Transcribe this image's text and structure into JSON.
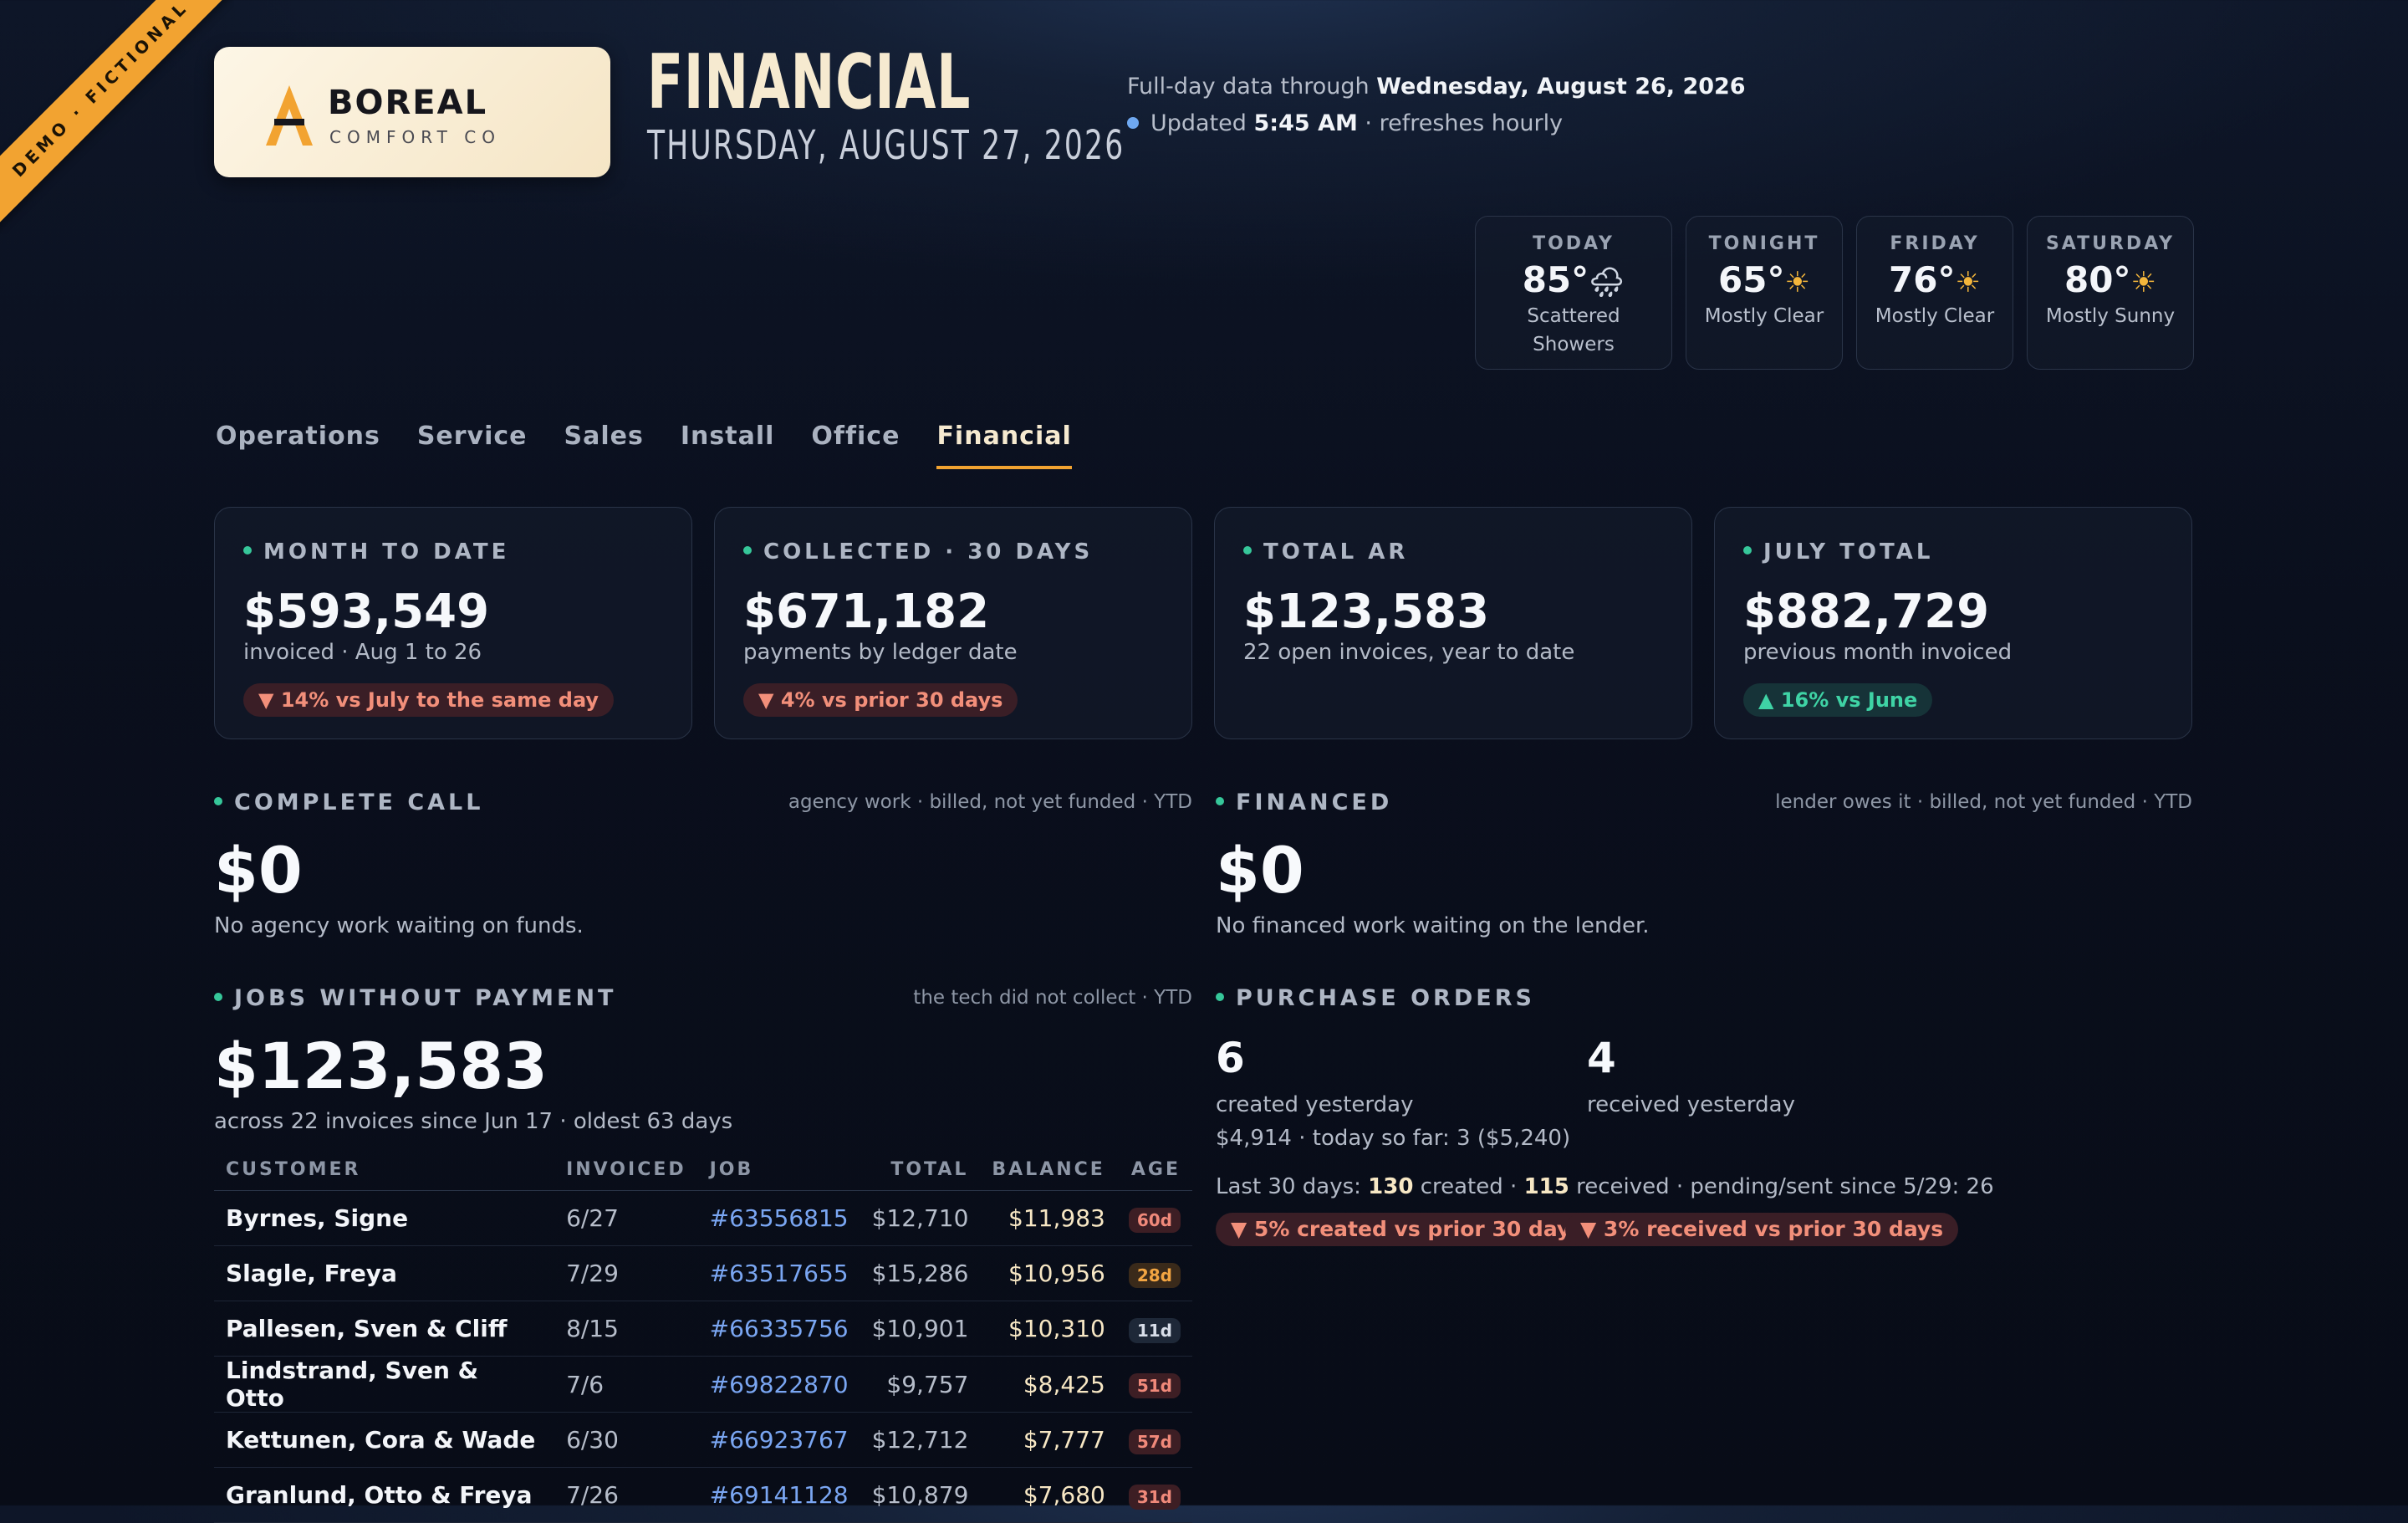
{
  "ribbon": "DEMO · FICTIONAL",
  "brand": {
    "name": "BOREAL",
    "sub": "COMFORT CO"
  },
  "header": {
    "title": "FINANCIAL",
    "date": "THURSDAY, AUGUST 27, 2026",
    "data_through_prefix": "Full-day data through ",
    "data_through": "Wednesday, August 26, 2026",
    "updated_prefix": "Updated ",
    "updated_time": "5:45 AM",
    "updated_suffix": " · refreshes hourly"
  },
  "weather": [
    {
      "label": "TODAY",
      "temp": "85°",
      "icon": "rain-cloud-icon",
      "glyph": "🌧",
      "cond1": "Scattered",
      "cond2": "Showers"
    },
    {
      "label": "TONIGHT",
      "temp": "65°",
      "icon": "sun-icon",
      "glyph": "☀",
      "cond1": "Mostly Clear",
      "cond2": ""
    },
    {
      "label": "FRIDAY",
      "temp": "76°",
      "icon": "sun-icon",
      "glyph": "☀",
      "cond1": "Mostly Clear",
      "cond2": ""
    },
    {
      "label": "SATURDAY",
      "temp": "80°",
      "icon": "sun-icon",
      "glyph": "☀",
      "cond1": "Mostly Sunny",
      "cond2": ""
    }
  ],
  "tabs": [
    "Operations",
    "Service",
    "Sales",
    "Install",
    "Office",
    "Financial"
  ],
  "active_tab": "Financial",
  "cards": [
    {
      "title": "MONTH TO DATE",
      "value": "$593,549",
      "sub": "invoiced · Aug 1 to 26",
      "pill": "▼ 14% vs July to the same day",
      "trend": "down"
    },
    {
      "title": "COLLECTED · 30 DAYS",
      "value": "$671,182",
      "sub": "payments by ledger date",
      "pill": "▼ 4% vs prior 30 days",
      "trend": "down"
    },
    {
      "title": "TOTAL AR",
      "value": "$123,583",
      "sub": "22 open invoices, year to date",
      "pill": "",
      "trend": ""
    },
    {
      "title": "JULY TOTAL",
      "value": "$882,729",
      "sub": "previous month invoiced",
      "pill": "▲ 16% vs June",
      "trend": "up"
    }
  ],
  "complete_call": {
    "title": "COMPLETE CALL",
    "note": "agency work · billed, not yet funded · YTD",
    "value": "$0",
    "desc": "No agency work waiting on funds."
  },
  "financed": {
    "title": "FINANCED",
    "note": "lender owes it · billed, not yet funded · YTD",
    "value": "$0",
    "desc": "No financed work waiting on the lender."
  },
  "jobs": {
    "title": "JOBS WITHOUT PAYMENT",
    "note": "the tech did not collect · YTD",
    "value": "$123,583",
    "desc": "across 22 invoices since Jun 17 · oldest 63 days",
    "columns": [
      "CUSTOMER",
      "INVOICED",
      "JOB",
      "TOTAL",
      "BALANCE",
      "AGE"
    ],
    "rows": [
      {
        "customer": "Byrnes, Signe",
        "invoiced": "6/27",
        "job": "#63556815",
        "total": "$12,710",
        "balance": "$11,983",
        "age": "60d",
        "age_color": "red"
      },
      {
        "customer": "Slagle, Freya",
        "invoiced": "7/29",
        "job": "#63517655",
        "total": "$15,286",
        "balance": "$10,956",
        "age": "28d",
        "age_color": "org"
      },
      {
        "customer": "Pallesen, Sven & Cliff",
        "invoiced": "8/15",
        "job": "#66335756",
        "total": "$10,901",
        "balance": "$10,310",
        "age": "11d",
        "age_color": "blu"
      },
      {
        "customer": "Lindstrand, Sven & Otto",
        "invoiced": "7/6",
        "job": "#69822870",
        "total": "$9,757",
        "balance": "$8,425",
        "age": "51d",
        "age_color": "red"
      },
      {
        "customer": "Kettunen, Cora & Wade",
        "invoiced": "6/30",
        "job": "#66923767",
        "total": "$12,712",
        "balance": "$7,777",
        "age": "57d",
        "age_color": "red"
      },
      {
        "customer": "Granlund, Otto & Freya",
        "invoiced": "7/26",
        "job": "#69141128",
        "total": "$10,879",
        "balance": "$7,680",
        "age": "31d",
        "age_color": "red"
      }
    ]
  },
  "purchase_orders": {
    "title": "PURCHASE ORDERS",
    "created": "6",
    "created_label": "created yesterday",
    "created_sub": "$4,914 · today so far: 3 ($5,240)",
    "received": "4",
    "received_label": "received yesterday",
    "last30_prefix": "Last 30 days: ",
    "last30_created": "130",
    "last30_mid": " created · ",
    "last30_received": "115",
    "last30_suffix": " received · pending/sent since 5/29: 26",
    "pill1": "▼ 5% created vs prior 30 days",
    "pill2": "▼ 3% received vs prior 30 days"
  }
}
